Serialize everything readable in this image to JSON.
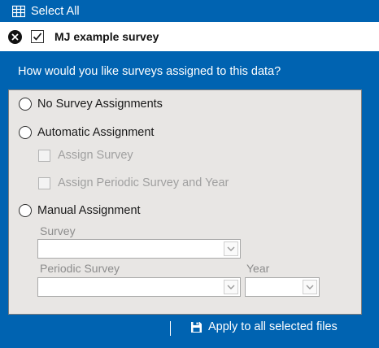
{
  "toolbar": {
    "select_all_label": "Select All"
  },
  "file": {
    "name": "MJ example survey",
    "checked": true
  },
  "panel": {
    "question": "How would you like surveys assigned to this data?",
    "options": {
      "none": "No Survey Assignments",
      "automatic": "Automatic Assignment",
      "assign_survey": "Assign Survey",
      "assign_periodic": "Assign Periodic Survey and Year",
      "manual": "Manual Assignment"
    },
    "fields": {
      "survey_label": "Survey",
      "survey_value": "",
      "periodic_label": "Periodic Survey",
      "periodic_value": "",
      "year_label": "Year",
      "year_value": ""
    },
    "apply_label": "Apply to all selected files"
  },
  "colors": {
    "accent": "#0063b1",
    "panel_bg": "#e8e6e4",
    "disabled_text": "#a0a0a0"
  },
  "icons": [
    "grid-icon",
    "close-icon",
    "checkmark-icon",
    "chevron-down-icon",
    "save-icon"
  ]
}
